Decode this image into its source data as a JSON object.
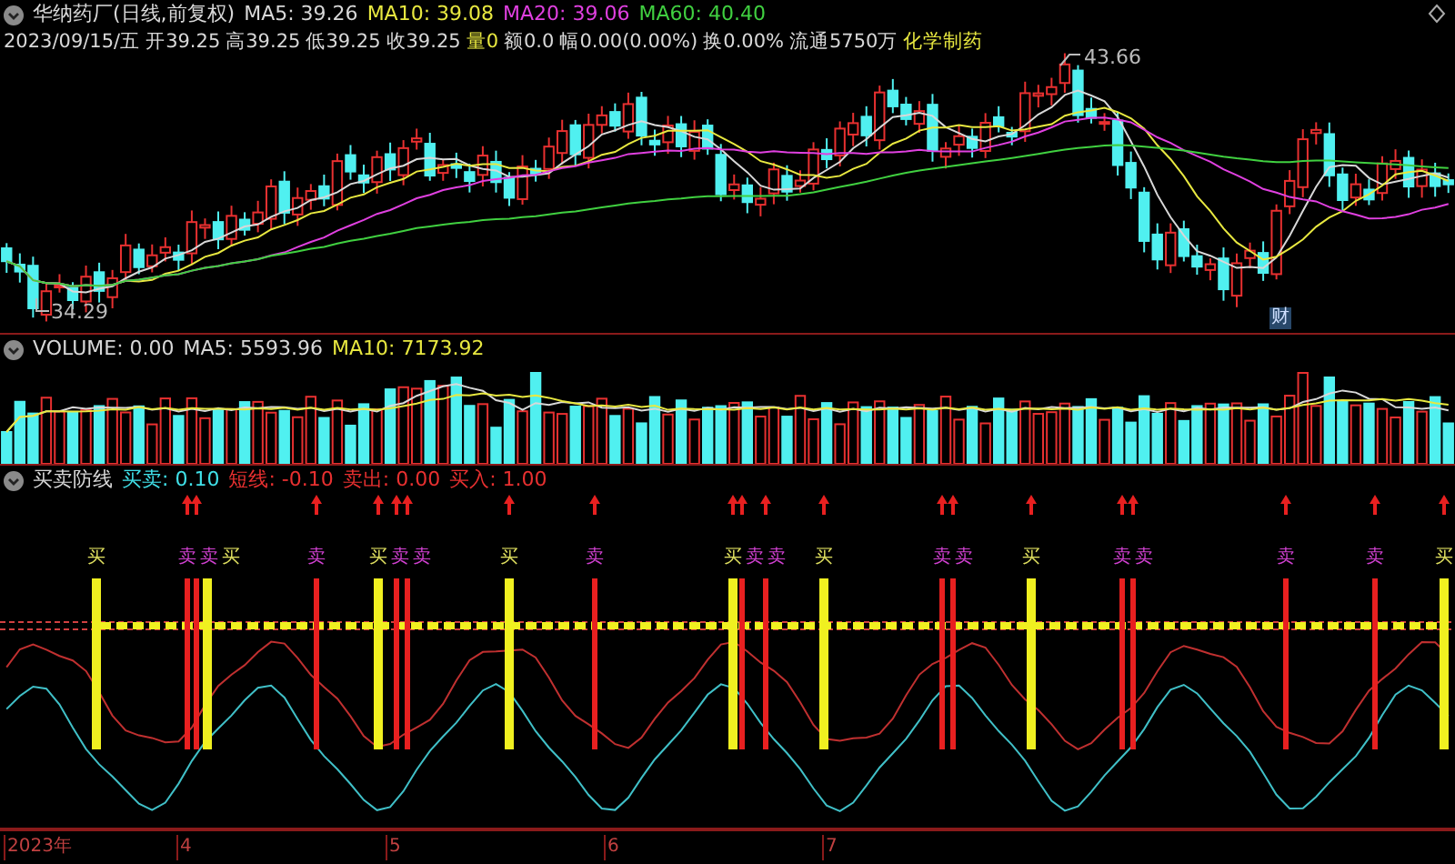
{
  "price_panel": {
    "title": "华纳药厂(日线,前复权)",
    "legend": [
      {
        "text": "MA5: 39.26",
        "color": "#d8d8d8"
      },
      {
        "text": "MA10: 39.08",
        "color": "#e8e840"
      },
      {
        "text": "MA20: 39.06",
        "color": "#e040e0"
      },
      {
        "text": "MA60: 40.40",
        "color": "#40d040"
      }
    ],
    "info": [
      {
        "text": "2023/09/15/五",
        "color": "#d8d8d8"
      },
      {
        "text": "开39.25",
        "color": "#d8d8d8"
      },
      {
        "text": "高39.25",
        "color": "#d8d8d8"
      },
      {
        "text": "低39.25",
        "color": "#d8d8d8"
      },
      {
        "text": "收39.25",
        "color": "#d8d8d8"
      },
      {
        "text": "量0",
        "color": "#e8e840"
      },
      {
        "text": "额0.0",
        "color": "#d8d8d8"
      },
      {
        "text": "幅0.00(0.00%)",
        "color": "#d8d8d8"
      },
      {
        "text": "换0.00%",
        "color": "#d8d8d8"
      },
      {
        "text": "流通5750万",
        "color": "#d8d8d8"
      },
      {
        "text": "化学制药",
        "color": "#e8e840"
      }
    ],
    "high_label": "43.66",
    "low_label": "34.29",
    "event_marker": "财"
  },
  "volume_panel": {
    "legend": [
      {
        "text": "VOLUME: 0.00",
        "color": "#d8d8d8"
      },
      {
        "text": "MA5: 5593.96",
        "color": "#d8d8d8"
      },
      {
        "text": "MA10: 7173.92",
        "color": "#e8e840"
      }
    ]
  },
  "indicator_panel": {
    "title": "买卖防线",
    "legend": [
      {
        "text": "买卖: 0.10",
        "color": "#40e0e8"
      },
      {
        "text": "短线: -0.10",
        "color": "#e83030"
      },
      {
        "text": "卖出: 0.00",
        "color": "#e83030"
      },
      {
        "text": "买入: 1.00",
        "color": "#e83030"
      }
    ],
    "signals": [
      {
        "kind": "buy",
        "label": "买"
      },
      {
        "kind": "sell",
        "label": "卖"
      },
      {
        "kind": "sell",
        "label": "卖"
      },
      {
        "kind": "buy",
        "label": "买"
      },
      {
        "kind": "sell",
        "label": "卖"
      },
      {
        "kind": "buy",
        "label": "买"
      },
      {
        "kind": "sell",
        "label": "卖"
      },
      {
        "kind": "sell",
        "label": "卖"
      },
      {
        "kind": "buy",
        "label": "买"
      },
      {
        "kind": "sell",
        "label": "卖"
      },
      {
        "kind": "buy",
        "label": "买"
      },
      {
        "kind": "sell",
        "label": "卖"
      },
      {
        "kind": "sell",
        "label": "卖"
      },
      {
        "kind": "buy",
        "label": "买"
      },
      {
        "kind": "sell",
        "label": "卖"
      },
      {
        "kind": "sell",
        "label": "卖"
      },
      {
        "kind": "buy",
        "label": "买"
      },
      {
        "kind": "sell",
        "label": "卖"
      },
      {
        "kind": "sell",
        "label": "卖"
      },
      {
        "kind": "sell",
        "label": "卖"
      },
      {
        "kind": "sell",
        "label": "卖"
      },
      {
        "kind": "buy",
        "label": "买"
      }
    ]
  },
  "time_axis": [
    "2023年",
    "4",
    "5",
    "6",
    "7"
  ]
}
